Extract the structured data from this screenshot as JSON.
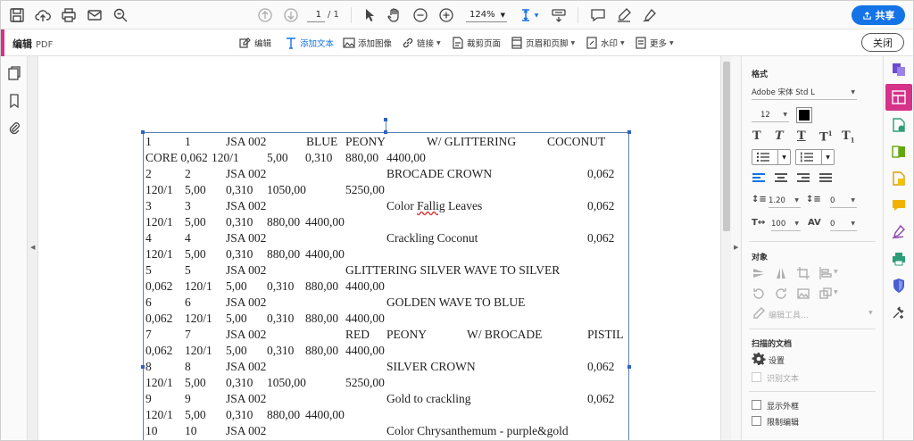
{
  "toolbar": {
    "page_current": "1",
    "page_total": "/ 1",
    "zoom": "124%",
    "share_label": "共享"
  },
  "editbar": {
    "title": "编辑",
    "title_suffix": "PDF",
    "tools": [
      {
        "label": "编辑",
        "icon": "edit-icon"
      },
      {
        "label": "添加文本",
        "icon": "add-text-icon"
      },
      {
        "label": "添加图像",
        "icon": "add-image-icon"
      },
      {
        "label": "链接",
        "icon": "link-icon"
      },
      {
        "label": "裁剪页面",
        "icon": "crop-page-icon"
      },
      {
        "label": "页眉和页脚",
        "icon": "header-footer-icon"
      },
      {
        "label": "水印",
        "icon": "watermark-icon"
      },
      {
        "label": "更多",
        "icon": "more-icon"
      }
    ],
    "close_label": "关闭"
  },
  "document": {
    "lines": [
      [
        "1",
        "1",
        "JSA 002",
        "BLUE",
        "PEONY",
        "W/ GLITTERING",
        "COCONUT"
      ],
      [
        "CORE 0,062",
        "120/1",
        "5,00",
        "0,310",
        "880,00",
        "4400,00"
      ],
      [
        "2",
        "2",
        "JSA 002",
        "BROCADE CROWN",
        "0,062"
      ],
      [
        "120/1",
        "5,00",
        "0,310",
        "1050,00",
        "5250,00"
      ],
      [
        "3",
        "3",
        "JSA 002",
        "Color Fallig Leaves",
        "0,062"
      ],
      [
        "120/1",
        "5,00",
        "0,310",
        "880,00",
        "4400,00"
      ],
      [
        "4",
        "4",
        "JSA 002",
        "Crackling Coconut",
        "0,062"
      ],
      [
        "120/1",
        "5,00",
        "0,310",
        "880,00",
        "4400,00"
      ],
      [
        "5",
        "5",
        "JSA 002",
        "GLITTERING SILVER WAVE TO SILVER"
      ],
      [
        "0,062",
        "120/1",
        "5,00",
        "0,310",
        "880,00",
        "4400,00"
      ],
      [
        "6",
        "6",
        "JSA 002",
        "GOLDEN WAVE TO BLUE"
      ],
      [
        "0,062",
        "120/1",
        "5,00",
        "0,310",
        "880,00",
        "4400,00"
      ],
      [
        "7",
        "7",
        "JSA 002",
        "RED",
        "PEONY",
        "W/ BROCADE",
        "PISTIL"
      ],
      [
        "0,062",
        "120/1",
        "5,00",
        "0,310",
        "880,00",
        "4400,00"
      ],
      [
        "8",
        "8",
        "JSA 002",
        "SILVER CROWN",
        "0,062"
      ],
      [
        "120/1",
        "5,00",
        "0,310",
        "1050,00",
        "5250,00"
      ],
      [
        "9",
        "9",
        "JSA 002",
        "Gold to crackling",
        "0,062"
      ],
      [
        "120/1",
        "5,00",
        "0,310",
        "880,00",
        "4400,00"
      ],
      [
        "10",
        "10",
        "JSA 002",
        "Color Chrysanthemum - purple&gold"
      ]
    ]
  },
  "format_panel": {
    "title": "格式",
    "font_name": "Adobe 宋体 Std L",
    "font_size": "12",
    "font_color": "#000000",
    "line_spacing": "1.20",
    "para_spacing": "0",
    "h_scale": "100",
    "char_spacing": "0",
    "objects_title": "对象",
    "edit_tool_label": "编辑工具...",
    "scan_title": "扫描的文档",
    "settings_label": "设置",
    "recognize_label": "识别文本",
    "show_bbox_label": "显示外框",
    "restrict_edit_label": "限制编辑"
  },
  "colors": {
    "accent": "#d6328a",
    "share": "#1473e6"
  }
}
